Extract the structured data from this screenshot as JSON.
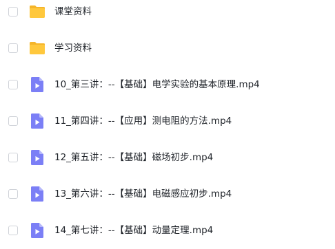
{
  "files": [
    {
      "name": "课堂资料",
      "type": "folder",
      "icon": "folder-icon"
    },
    {
      "name": "学习资料",
      "type": "folder",
      "icon": "folder-icon"
    },
    {
      "name": "10_第三讲：--【基础】电学实验的基本原理.mp4",
      "type": "video",
      "icon": "video-file-icon"
    },
    {
      "name": "11_第四讲：--【应用】测电阻的方法.mp4",
      "type": "video",
      "icon": "video-file-icon"
    },
    {
      "name": "12_第五讲：--【基础】磁场初步.mp4",
      "type": "video",
      "icon": "video-file-icon"
    },
    {
      "name": "13_第六讲：--【基础】电磁感应初步.mp4",
      "type": "video",
      "icon": "video-file-icon"
    },
    {
      "name": "14_第七讲：--【基础】动量定理.mp4",
      "type": "video",
      "icon": "video-file-icon"
    }
  ],
  "colors": {
    "folder": "#ffc83d",
    "folder_back": "#f5b52a",
    "video": "#7b7ff6",
    "video_fold": "#b7b9fb",
    "text": "#1f2329",
    "checkbox_border": "#d0d3d9"
  }
}
